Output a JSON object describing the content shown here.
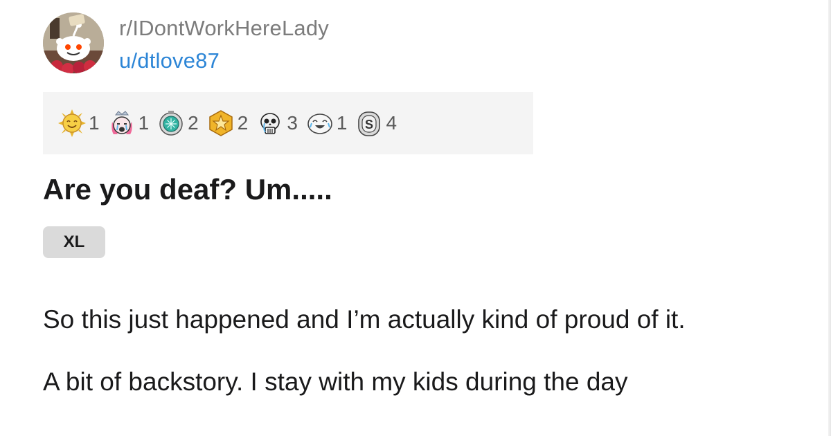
{
  "post": {
    "subreddit": "r/IDontWorkHereLady",
    "username": "u/dtlove87",
    "title": "Are you deaf? Um.....",
    "flair": "XL",
    "paragraphs": [
      "So this just happened and I’m actually kind of proud of it.",
      "A bit of backstory. I stay with my kids during the day"
    ]
  },
  "awards": [
    {
      "icon": "sun-award-icon",
      "count": "1"
    },
    {
      "icon": "crying-princess-award-icon",
      "count": "1"
    },
    {
      "icon": "teal-gem-medal-award-icon",
      "count": "2"
    },
    {
      "icon": "gold-star-award-icon",
      "count": "2"
    },
    {
      "icon": "skull-award-icon",
      "count": "3"
    },
    {
      "icon": "laughing-face-award-icon",
      "count": "1"
    },
    {
      "icon": "silver-s-award-icon",
      "count": "4"
    }
  ],
  "colors": {
    "subreddit_text": "#7c7c7c",
    "username_link": "#2c85d6",
    "awards_bar_bg": "#f4f4f4",
    "flair_bg": "#dadada",
    "text": "#1a1a1b"
  }
}
